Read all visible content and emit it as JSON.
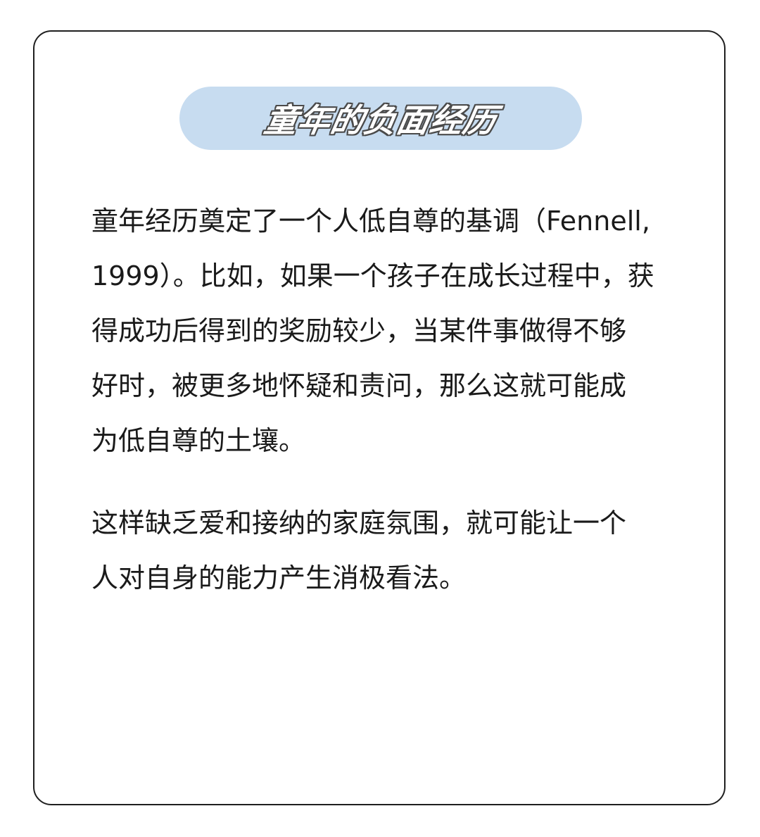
{
  "title": "童年的负面经历",
  "paragraphs": [
    {
      "lines": [
        "童年经历奠定了一个人低自尊的基调（Fennell,",
        "1999）。比如，如果一个孩子在成长过程中，获",
        "得成功后得到的奖励较少，当某件事做得不够",
        "好时，被更多地怀疑和责问，那么这就可能成",
        "为低自尊的土壤。"
      ]
    },
    {
      "lines": [
        "这样缺乏爱和接纳的家庭氛围，就可能让一个",
        "人对自身的能力产生消极看法。"
      ]
    }
  ]
}
